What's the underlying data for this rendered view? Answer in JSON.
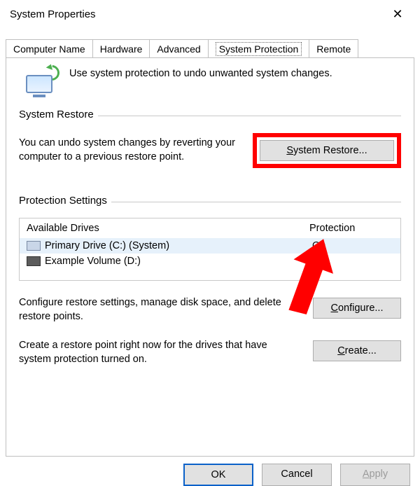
{
  "window": {
    "title": "System Properties",
    "close_glyph": "✕"
  },
  "tabs": [
    {
      "label": "Computer Name",
      "selected": false
    },
    {
      "label": "Hardware",
      "selected": false
    },
    {
      "label": "Advanced",
      "selected": false
    },
    {
      "label": "System Protection",
      "selected": true
    },
    {
      "label": "Remote",
      "selected": false
    }
  ],
  "intro_text": "Use system protection to undo unwanted system changes.",
  "system_restore": {
    "legend": "System Restore",
    "description": "You can undo system changes by reverting your computer to a previous restore point.",
    "button_prefix": "S",
    "button_rest": "ystem Restore..."
  },
  "protection_settings": {
    "legend": "Protection Settings",
    "columns": {
      "drives": "Available Drives",
      "protection": "Protection"
    },
    "rows": [
      {
        "name": "Primary Drive (C:) (System)",
        "protection": "On",
        "selected": true,
        "icon": "light"
      },
      {
        "name": "Example Volume (D:)",
        "protection": "Off",
        "selected": false,
        "icon": "dark"
      }
    ]
  },
  "configure": {
    "description": "Configure restore settings, manage disk space, and delete restore points.",
    "button_prefix": "C",
    "button_rest": "onfigure..."
  },
  "create": {
    "description": "Create a restore point right now for the drives that have system protection turned on.",
    "button_prefix": "C",
    "button_rest": "reate..."
  },
  "buttons": {
    "ok": "OK",
    "cancel": "Cancel",
    "apply_prefix": "A",
    "apply_rest": "pply"
  },
  "annotation": {
    "highlight_color": "#ff0000"
  }
}
